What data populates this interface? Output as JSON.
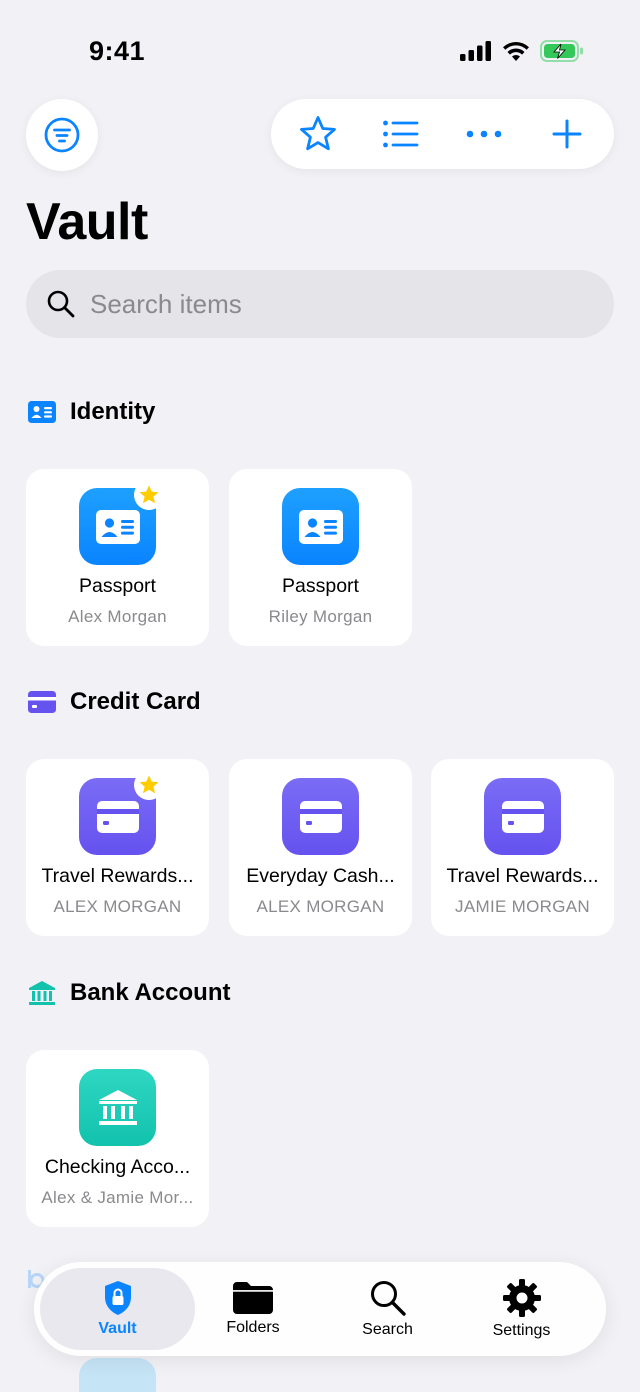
{
  "status_bar": {
    "time": "9:41"
  },
  "toolbar": {
    "filter_icon": "filter-lines-icon",
    "favorites_icon": "star-icon",
    "list_icon": "list-icon",
    "more_icon": "ellipsis-icon",
    "add_icon": "plus-icon"
  },
  "page": {
    "title": "Vault"
  },
  "search": {
    "placeholder": "Search items"
  },
  "sections": [
    {
      "title": "Identity",
      "icon": "id-card-icon",
      "items": [
        {
          "title": "Passport",
          "subtitle": "Alex Morgan",
          "favorite": true
        },
        {
          "title": "Passport",
          "subtitle": "Riley Morgan",
          "favorite": false
        }
      ]
    },
    {
      "title": "Credit Card",
      "icon": "credit-card-icon",
      "items": [
        {
          "title": "Travel Rewards...",
          "subtitle": "ALEX MORGAN",
          "favorite": true
        },
        {
          "title": "Everyday Cash...",
          "subtitle": "ALEX MORGAN",
          "favorite": false
        },
        {
          "title": "Travel Rewards...",
          "subtitle": "JAMIE MORGAN",
          "favorite": false
        }
      ]
    },
    {
      "title": "Bank Account",
      "icon": "bank-icon",
      "items": [
        {
          "title": "Checking Acco...",
          "subtitle": "Alex & Jamie Mor...",
          "favorite": false
        }
      ]
    }
  ],
  "tabbar": {
    "tabs": [
      {
        "label": "Vault",
        "icon": "shield-lock-icon",
        "active": true
      },
      {
        "label": "Folders",
        "icon": "folder-icon",
        "active": false
      },
      {
        "label": "Search",
        "icon": "search-icon",
        "active": false
      },
      {
        "label": "Settings",
        "icon": "gear-icon",
        "active": false
      }
    ]
  },
  "colors": {
    "accent": "#0a84ff",
    "identity": "#0a84ff",
    "credit_card": "#6552ef",
    "bank": "#12c2ad",
    "favorite_star": "#ffcc00",
    "background": "#f2f2f6"
  }
}
